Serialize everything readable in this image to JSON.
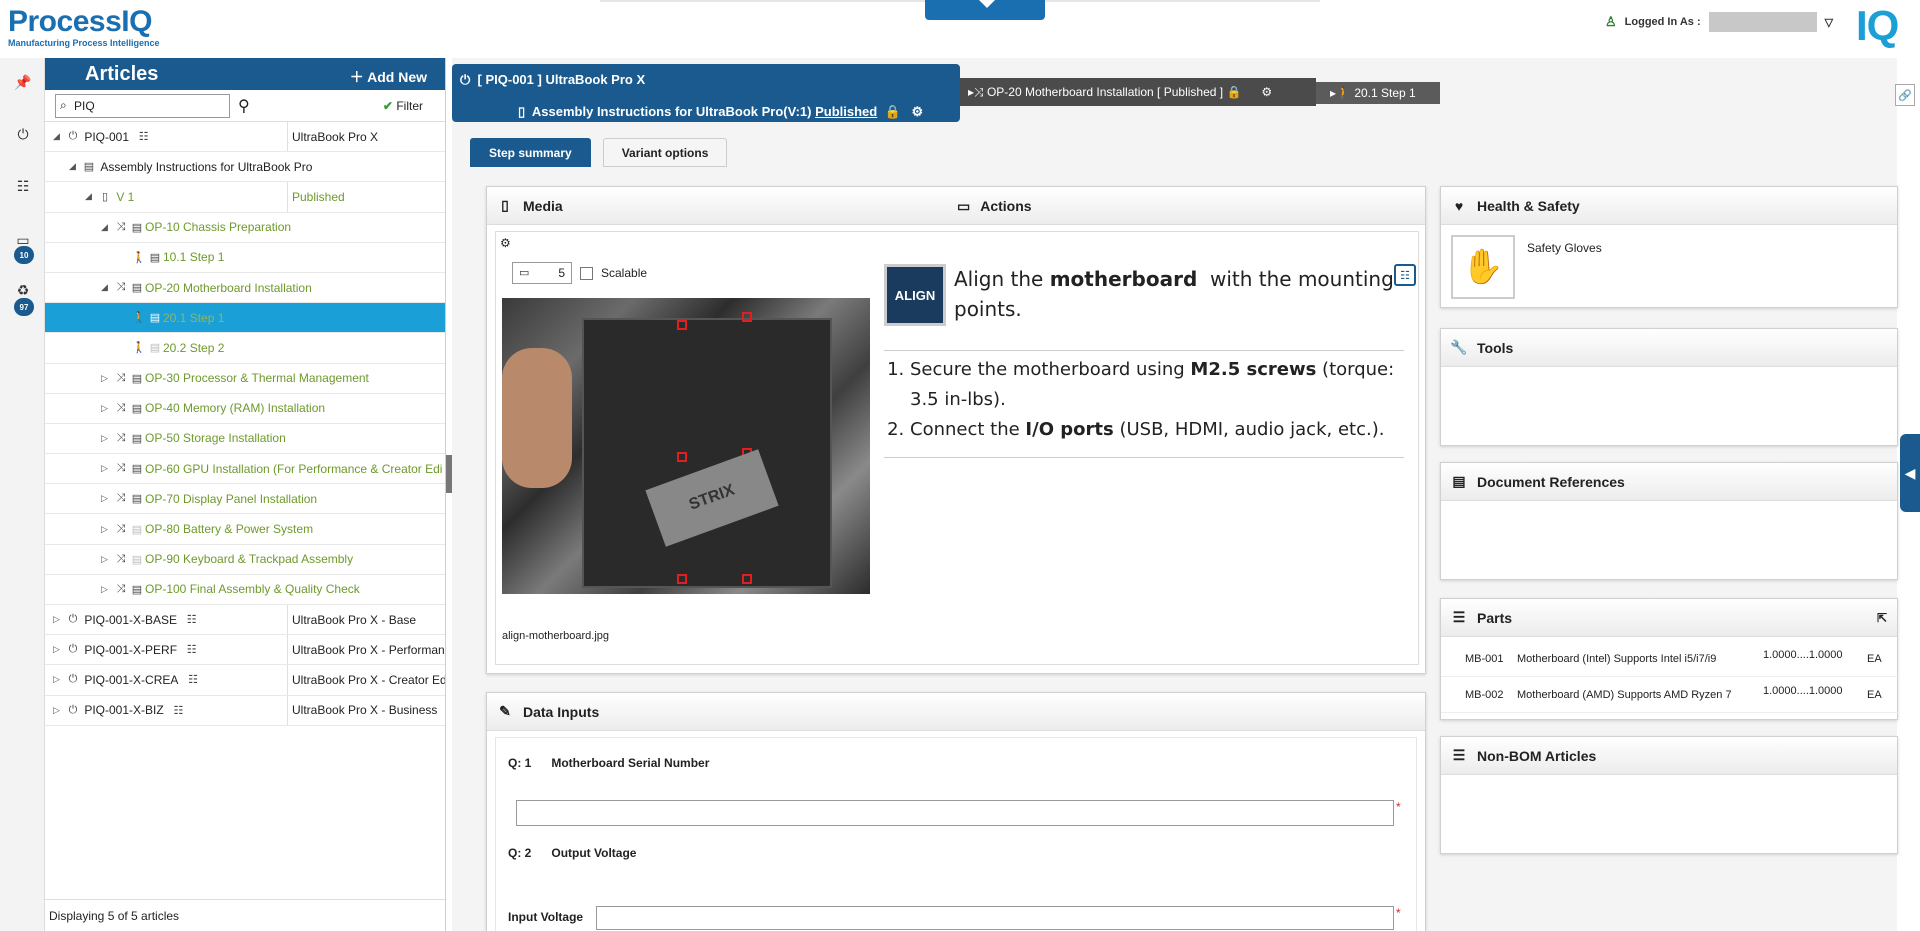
{
  "header": {
    "logo_main": "ProcessIQ",
    "logo_sub": "Manufacturing Process Intelligence",
    "logged_in_label": "Logged In As :",
    "right_logo": "IQ"
  },
  "rail": {
    "badge_comments": "10",
    "badge_recycle": "97"
  },
  "articles": {
    "title": "Articles",
    "add_new": "Add New",
    "search_value": "PIQ",
    "filter_label": "Filter",
    "footer": "Displaying 5 of 5 articles",
    "rows": [
      {
        "label": "PIQ-001",
        "col2": "UltraBook Pro X"
      },
      {
        "label": "Assembly Instructions for UltraBook Pro",
        "col2": ""
      },
      {
        "label": "V 1",
        "col2": "Published"
      },
      {
        "label": "OP-10 Chassis Preparation",
        "col2": ""
      },
      {
        "label": "10.1 Step 1",
        "col2": ""
      },
      {
        "label": "OP-20 Motherboard Installation",
        "col2": ""
      },
      {
        "label": "20.1 Step 1",
        "col2": ""
      },
      {
        "label": "20.2 Step 2",
        "col2": ""
      },
      {
        "label": "OP-30 Processor & Thermal Management",
        "col2": ""
      },
      {
        "label": "OP-40 Memory (RAM) Installation",
        "col2": ""
      },
      {
        "label": "OP-50 Storage Installation",
        "col2": ""
      },
      {
        "label": "OP-60 GPU Installation (For Performance & Creator Edi",
        "col2": ""
      },
      {
        "label": "OP-70 Display Panel Installation",
        "col2": ""
      },
      {
        "label": "OP-80 Battery & Power System",
        "col2": ""
      },
      {
        "label": "OP-90 Keyboard & Trackpad Assembly",
        "col2": ""
      },
      {
        "label": "OP-100 Final Assembly & Quality Check",
        "col2": ""
      },
      {
        "label": "PIQ-001-X-BASE",
        "col2": "UltraBook Pro X - Base"
      },
      {
        "label": "PIQ-001-X-PERF",
        "col2": "UltraBook Pro X - Performanc"
      },
      {
        "label": "PIQ-001-X-CREA",
        "col2": "UltraBook Pro X - Creator Edi"
      },
      {
        "label": "PIQ-001-X-BIZ",
        "col2": "UltraBook Pro X - Business"
      }
    ]
  },
  "breadcrumb": {
    "line1": "[ PIQ-001 ]  UltraBook Pro X",
    "line2_prefix": "Assembly Instructions for UltraBook Pro(V:1)",
    "line2_status": "Published",
    "op": "OP-20 Motherboard Installation [ Published ]",
    "step": "20.1 Step 1"
  },
  "tabs": {
    "step_summary": "Step summary",
    "variant_options": "Variant options"
  },
  "media": {
    "title": "Media",
    "actions_title": "Actions",
    "scale_value": "5",
    "scalable_label": "Scalable",
    "caption": "align-motherboard.jpg",
    "align_badge": "ALIGN",
    "photo_text": "STRIX",
    "instr_pre": "Align the",
    "instr_bold": "motherboard",
    "instr_post": "with the mounting points.",
    "step1_pre": "Secure the motherboard using",
    "step1_bold": "M2.5 screws",
    "step1_post": "(torque: 3.5 in-lbs).",
    "step2_pre": "Connect the",
    "step2_bold": "I/O ports",
    "step2_post": "(USB, HDMI, audio jack, etc.)."
  },
  "data_inputs": {
    "title": "Data Inputs",
    "q1_num": "Q: 1",
    "q1_label": "Motherboard Serial Number",
    "q2_num": "Q: 2",
    "q2_label": "Output Voltage",
    "input_voltage_label": "Input Voltage",
    "required_mark": "*"
  },
  "health_safety": {
    "title": "Health & Safety",
    "item": "Safety Gloves"
  },
  "tools": {
    "title": "Tools"
  },
  "doc_refs": {
    "title": "Document References"
  },
  "parts": {
    "title": "Parts",
    "rows": [
      {
        "code": "MB-001",
        "desc": "Motherboard (Intel) Supports Intel i5/i7/i9",
        "qty": "1.0000....1.0000",
        "uom": "EA"
      },
      {
        "code": "MB-002",
        "desc": "Motherboard (AMD) Supports AMD Ryzen 7",
        "qty": "1.0000....1.0000",
        "uom": "EA"
      }
    ]
  },
  "non_bom": {
    "title": "Non-BOM Articles"
  },
  "colors": {
    "brand": "#1a5a8e",
    "accent": "#1a9fd6",
    "selected_row": "#1a9fd6",
    "tree_green": "#6e9a2c"
  }
}
